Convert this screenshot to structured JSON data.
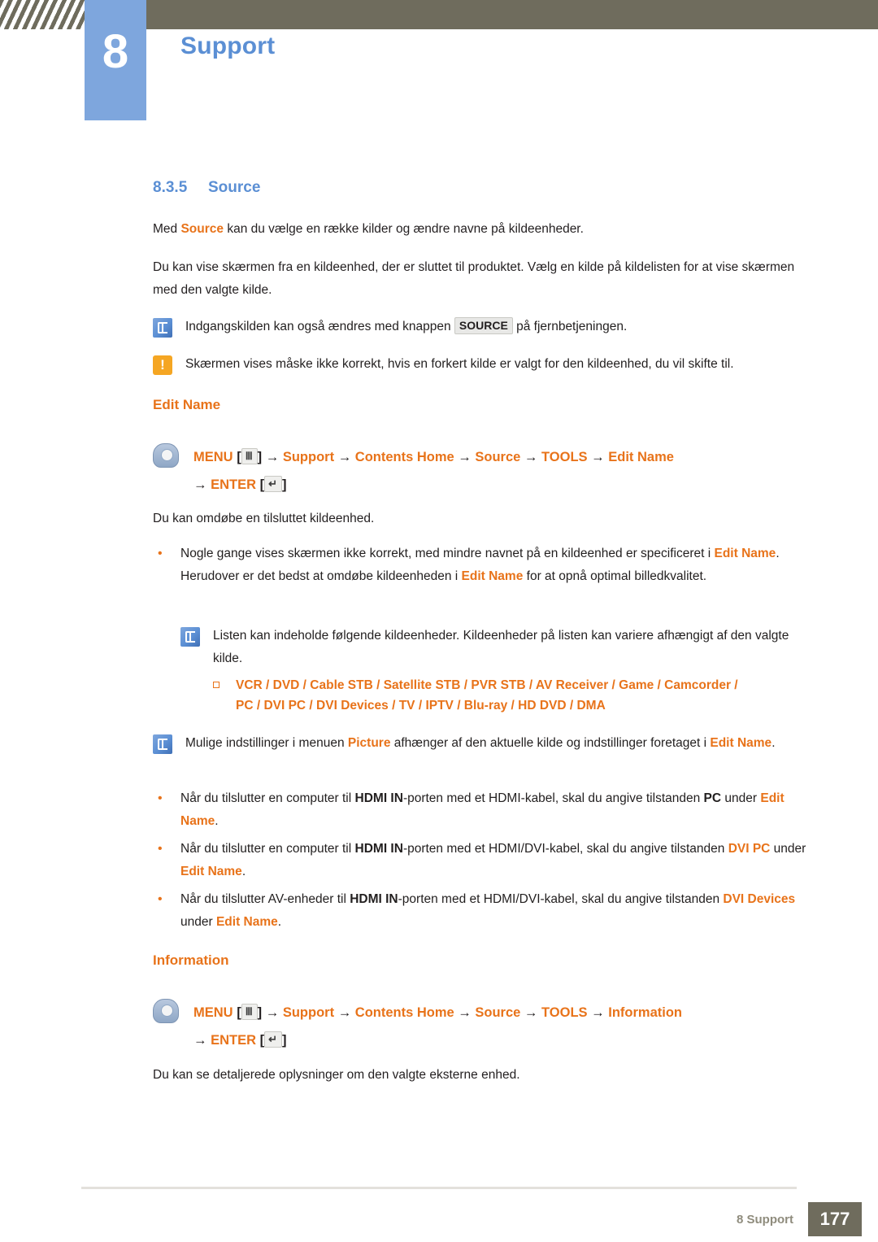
{
  "header": {
    "chapter_number": "8",
    "chapter_title": "Support"
  },
  "section": {
    "number": "8.3.5",
    "title": "Source"
  },
  "intro": {
    "p1_a": "Med ",
    "p1_b": "Source",
    "p1_c": " kan du vælge en række kilder og ændre navne på kildeenheder.",
    "p2": "Du kan vise skærmen fra en kildeenhed, der er sluttet til produktet. Vælg en kilde på kildelisten for at vise skærmen med den valgte kilde."
  },
  "notes": {
    "note1_a": "Indgangskilden kan også ændres med knappen ",
    "note1_key": "SOURCE",
    "note1_b": " på fjernbetjeningen.",
    "caution1": "Skærmen vises måske ikke korrekt, hvis en forkert kilde er valgt for den kildeenhed, du vil skifte til."
  },
  "edit_name": {
    "heading": "Edit Name",
    "menu": {
      "menu_label": "MENU",
      "menu_glyph": "Ⅲ",
      "arrow": "→",
      "support": "Support",
      "contents_home": "Contents Home",
      "source": "Source",
      "tools": "TOOLS",
      "target": "Edit Name",
      "enter_label": "ENTER",
      "enter_glyph": "↵"
    },
    "desc": "Du kan omdøbe en tilsluttet kildeenhed.",
    "bullet1": {
      "a": "Nogle gange vises skærmen ikke korrekt, med mindre navnet på en kildeenhed er specificeret i ",
      "b": "Edit Name",
      "c": ". Herudover er det bedst at omdøbe kildeenheden i ",
      "d": "Edit Name",
      "e": " for at opnå optimal billedkvalitet."
    },
    "subnote": "Listen kan indeholde følgende kildeenheder. Kildeenheder på listen kan variere afhængigt af den valgte kilde.",
    "device_line_1": "VCR / DVD / Cable STB / Satellite STB / PVR STB / AV Receiver / Game / Camcorder /",
    "device_line_2": "PC / DVI PC / DVI Devices / TV / IPTV / Blu-ray / HD DVD / DMA",
    "note2": {
      "a": "Mulige indstillinger i menuen ",
      "b": "Picture",
      "c": " afhænger af den aktuelle kilde og indstillinger foretaget i ",
      "d": "Edit Name",
      "e": "."
    },
    "bullet2": {
      "a": "Når du tilslutter en computer til ",
      "b": "HDMI IN",
      "c": "-porten med et HDMI-kabel, skal du angive tilstanden ",
      "d": "PC",
      "e": " under ",
      "f": "Edit Name",
      "g": "."
    },
    "bullet3": {
      "a": "Når du tilslutter en computer til ",
      "b": "HDMI IN",
      "c": "-porten med et HDMI/DVI-kabel, skal du angive tilstanden ",
      "d": "DVI PC",
      "e": " under ",
      "f": "Edit Name",
      "g": "."
    },
    "bullet4": {
      "a": "Når du tilslutter AV-enheder til ",
      "b": "HDMI IN",
      "c": "-porten med et HDMI/DVI-kabel, skal du angive tilstanden ",
      "d": "DVI Devices",
      "e": " under ",
      "f": "Edit Name",
      "g": "."
    }
  },
  "information": {
    "heading": "Information",
    "menu": {
      "menu_label": "MENU",
      "menu_glyph": "Ⅲ",
      "arrow": "→",
      "support": "Support",
      "contents_home": "Contents Home",
      "source": "Source",
      "tools": "TOOLS",
      "target": "Information",
      "enter_label": "ENTER",
      "enter_glyph": "↵"
    },
    "desc": "Du kan se detaljerede oplysninger om den valgte eksterne enhed."
  },
  "footer": {
    "label": "8 Support",
    "page": "177"
  },
  "colors": {
    "accent_blue": "#5b8fd4",
    "accent_orange": "#e8731a",
    "header_bar": "#6f6c5d",
    "caution": "#f5a623"
  }
}
